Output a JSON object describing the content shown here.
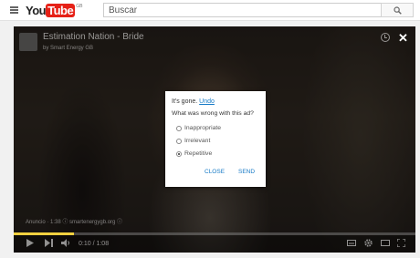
{
  "header": {
    "logo_you": "You",
    "logo_tube": "Tube",
    "logo_country": "GB",
    "search_placeholder": "Buscar"
  },
  "player": {
    "title": "Estimation Nation - Bride",
    "subtitle": "by Smart Energy GB",
    "ad_info": "Anuncio · 1:38 ⓘ  smartenergygb.org ⓘ",
    "time_current": "0:10",
    "time_total": "1:08",
    "progress_fraction": 0.15,
    "progress_color": "#f2d140"
  },
  "dialog": {
    "gone_text": "It's gone.",
    "undo_label": "Undo",
    "question": "What was wrong with this ad?",
    "options": [
      {
        "label": "Inappropriate",
        "selected": false
      },
      {
        "label": "Irrelevant",
        "selected": false
      },
      {
        "label": "Repetitive",
        "selected": true
      }
    ],
    "close_label": "CLOSE",
    "send_label": "SEND",
    "link_color": "#167ac6"
  },
  "icons": [
    "menu-icon",
    "search-icon",
    "clock-icon",
    "close-icon",
    "play-icon",
    "next-icon",
    "volume-icon",
    "subtitles-icon",
    "gear-icon",
    "theater-icon",
    "fullscreen-icon"
  ]
}
